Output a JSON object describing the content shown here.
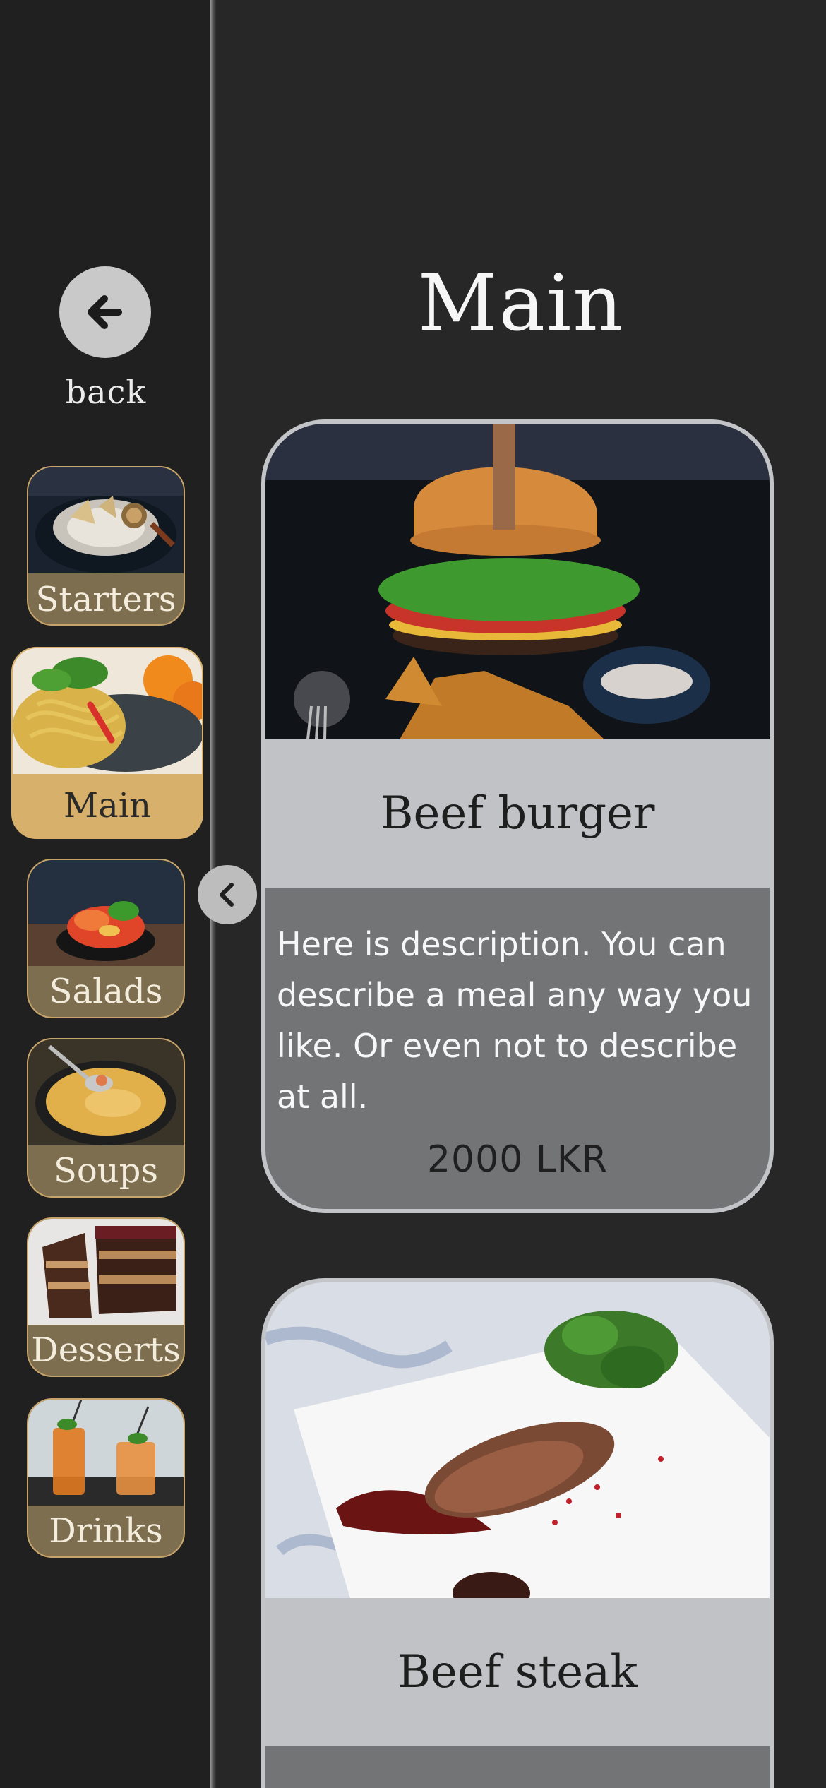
{
  "sidebar": {
    "back_label": "back",
    "categories": [
      {
        "label": "Starters",
        "active": false
      },
      {
        "label": "Main",
        "active": true
      },
      {
        "label": "Salads",
        "active": false
      },
      {
        "label": "Soups",
        "active": false
      },
      {
        "label": "Desserts",
        "active": false
      },
      {
        "label": "Drinks",
        "active": false
      }
    ]
  },
  "main": {
    "title": "Main",
    "items": [
      {
        "name": "Beef burger",
        "description": "Here is description. You can describe a meal any way you like. Or even not to describe at all.",
        "price": "2000 LKR"
      },
      {
        "name": "Beef steak"
      }
    ]
  },
  "colors": {
    "background": "#272727",
    "sidebar": "#202020",
    "accent_gold": "#d7b06b",
    "card": "#c0c2c6",
    "description_area": "#737476"
  },
  "icons": {
    "back": "arrow-left-icon",
    "collapse": "chevron-left-icon"
  }
}
